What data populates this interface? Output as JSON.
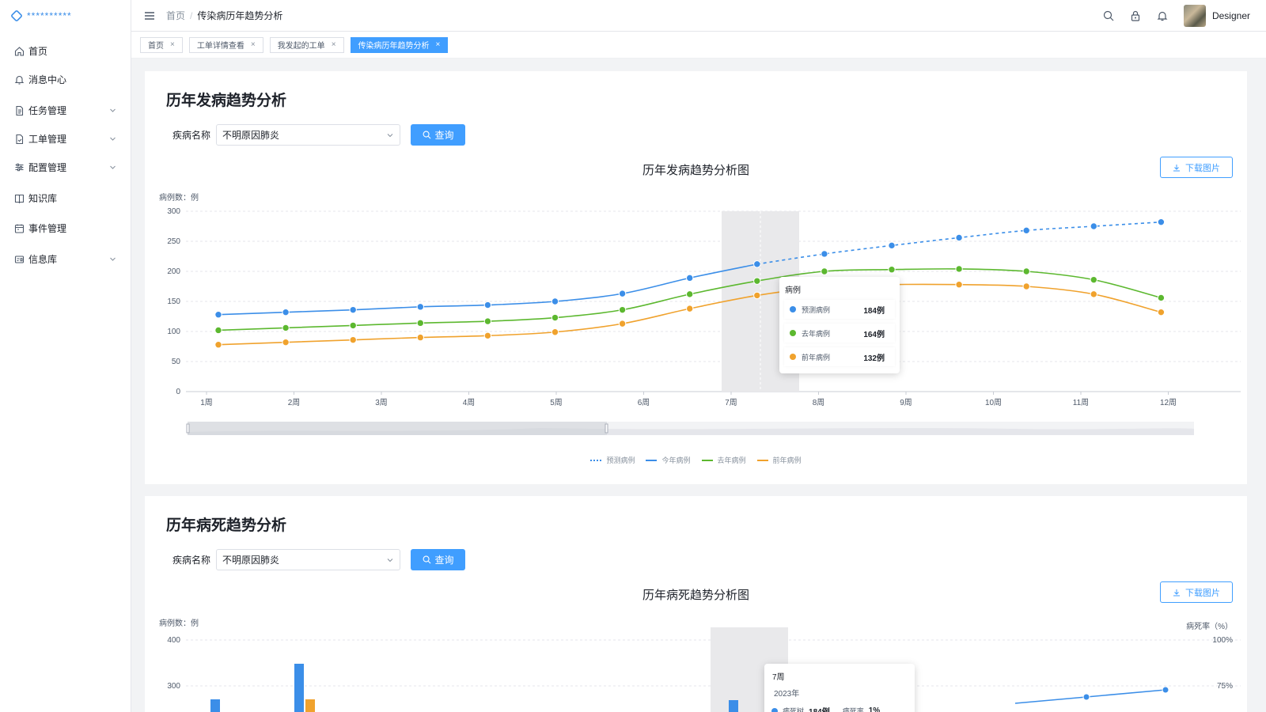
{
  "app": {
    "logo_text": "**********"
  },
  "sidebar": {
    "items": [
      {
        "label": "首页",
        "icon": "home-icon",
        "expandable": false
      },
      {
        "label": "消息中心",
        "icon": "bell-icon",
        "expandable": false
      },
      {
        "label": "任务管理",
        "icon": "document-icon",
        "expandable": true
      },
      {
        "label": "工单管理",
        "icon": "document-check-icon",
        "expandable": true
      },
      {
        "label": "配置管理",
        "icon": "sliders-icon",
        "expandable": true
      },
      {
        "label": "知识库",
        "icon": "book-icon",
        "expandable": false
      },
      {
        "label": "事件管理",
        "icon": "calendar-icon",
        "expandable": false
      },
      {
        "label": "信息库",
        "icon": "id-card-icon",
        "expandable": true
      }
    ]
  },
  "header": {
    "breadcrumb": {
      "home": "首页",
      "separator": "/",
      "current": "传染病历年趋势分析"
    },
    "user": {
      "name": "Designer"
    }
  },
  "tabs": [
    {
      "label": "首页",
      "active": false
    },
    {
      "label": "工单详情查看",
      "active": false
    },
    {
      "label": "我发起的工单",
      "active": false
    },
    {
      "label": "传染病历年趋势分析",
      "active": true
    }
  ],
  "section1": {
    "title": "历年发病趋势分析",
    "filter_label": "疾病名称",
    "select_value": "不明原因肺炎",
    "query_label": "查询",
    "download_label": "下载图片",
    "tooltip": {
      "title": "病例",
      "rows": [
        {
          "label": "预测病例",
          "value": "184例",
          "color": "#3b8ee8"
        },
        {
          "label": "去年病例",
          "value": "164例",
          "color": "#5cb82f"
        },
        {
          "label": "前年病例",
          "value": "132例",
          "color": "#f0a22d"
        }
      ]
    }
  },
  "section2": {
    "title": "历年病死趋势分析",
    "filter_label": "疾病名称",
    "select_value": "不明原因肺炎",
    "query_label": "查询",
    "download_label": "下载图片",
    "tooltip": {
      "title": "7周",
      "subtitle": "2023年",
      "count_label": "病死树",
      "count_value": "184例",
      "rate_label": "病死率",
      "rate_value": "1%"
    }
  },
  "chart_data": [
    {
      "type": "line",
      "title": "历年发病趋势分析图",
      "ylabel": "病例数：例",
      "ylim": [
        0,
        300
      ],
      "yticks": [
        0,
        50,
        100,
        150,
        200,
        250,
        300
      ],
      "categories": [
        "1周",
        "2周",
        "3周",
        "4周",
        "5周",
        "6周",
        "7周",
        "8周",
        "9周",
        "10周",
        "11周",
        "12周"
      ],
      "highlight_category": "7周",
      "legend": [
        "预测病例",
        "今年病例",
        "去年病例",
        "前年病例"
      ],
      "series": [
        {
          "name": "今年病例",
          "color": "#3b8ee8",
          "points": [
            [
              0,
              128
            ],
            [
              1,
              132
            ],
            [
              2,
              136
            ],
            [
              3,
              141
            ],
            [
              4,
              144
            ],
            [
              5,
              150
            ],
            [
              6,
              163
            ],
            [
              7,
              189
            ],
            [
              8,
              212
            ]
          ]
        },
        {
          "name": "预测病例",
          "color": "#3b8ee8",
          "dashed": true,
          "points": [
            [
              8,
              212
            ],
            [
              9,
              229
            ],
            [
              10,
              243
            ],
            [
              11,
              256
            ],
            [
              12,
              268
            ],
            [
              13,
              275
            ],
            [
              14,
              282
            ]
          ]
        },
        {
          "name": "去年病例",
          "color": "#5cb82f",
          "points": [
            [
              0,
              102
            ],
            [
              1,
              106
            ],
            [
              2,
              110
            ],
            [
              3,
              114
            ],
            [
              4,
              117
            ],
            [
              5,
              123
            ],
            [
              6,
              136
            ],
            [
              7,
              162
            ],
            [
              8,
              184
            ],
            [
              9,
              200
            ],
            [
              10,
              203
            ],
            [
              11,
              204
            ],
            [
              12,
              200
            ],
            [
              13,
              186
            ],
            [
              14,
              156
            ]
          ]
        },
        {
          "name": "前年病例",
          "color": "#f0a22d",
          "points": [
            [
              0,
              78
            ],
            [
              1,
              82
            ],
            [
              2,
              86
            ],
            [
              3,
              90
            ],
            [
              4,
              93
            ],
            [
              5,
              99
            ],
            [
              6,
              113
            ],
            [
              7,
              138
            ],
            [
              8,
              160
            ],
            [
              9,
              174
            ],
            [
              10,
              178
            ],
            [
              11,
              178
            ],
            [
              12,
              175
            ],
            [
              13,
              162
            ],
            [
              14,
              132
            ]
          ]
        }
      ]
    },
    {
      "type": "bar",
      "title": "历年病死趋势分析图",
      "ylabel": "病例数：例",
      "y2label": "病死率（%）",
      "yticks": [
        300,
        400
      ],
      "y2ticks": [
        "75%",
        "100%"
      ]
    }
  ]
}
